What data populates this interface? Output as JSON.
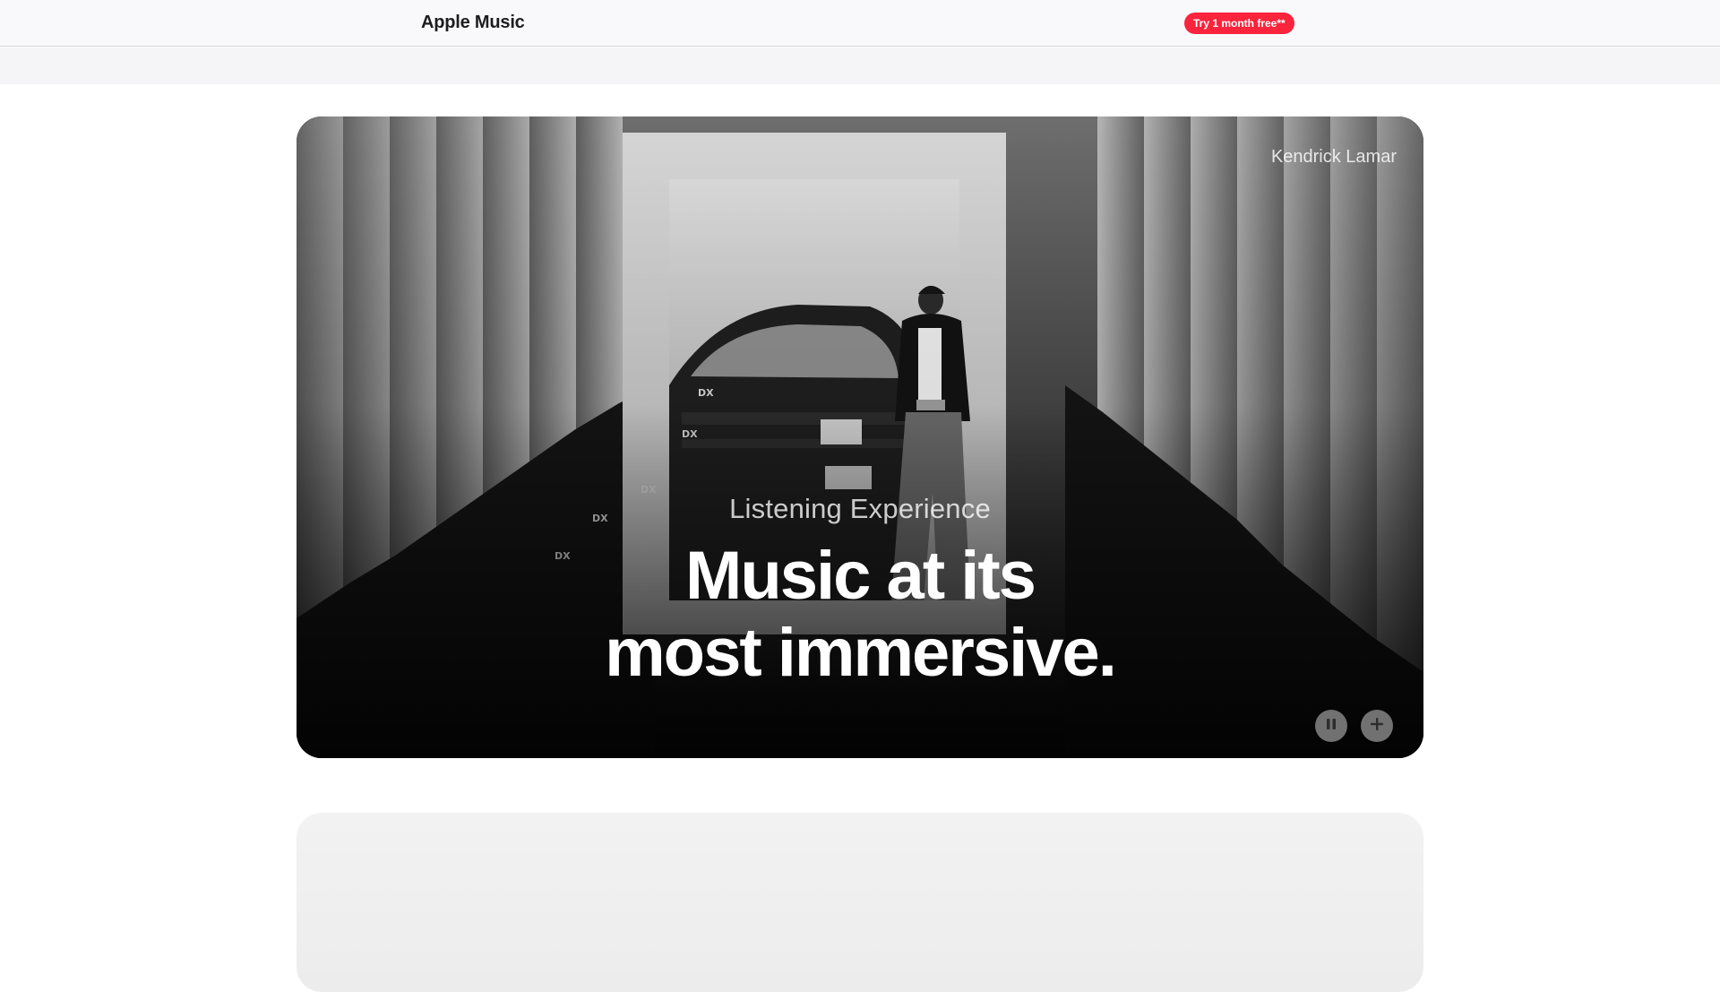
{
  "nav": {
    "brand": "Apple Music",
    "trial_label": "Try 1 month free**"
  },
  "hero": {
    "artist": "Kendrick Lamar",
    "eyebrow": "Listening Experience",
    "headline_line1": "Music at its",
    "headline_line2": "most immersive.",
    "controls": {
      "pause_icon": "pause-icon",
      "add_icon": "plus-icon"
    }
  },
  "colors": {
    "accent": "#fa243c",
    "nav_bg": "#f9f9fb",
    "subbar_bg": "#f5f5f7"
  }
}
